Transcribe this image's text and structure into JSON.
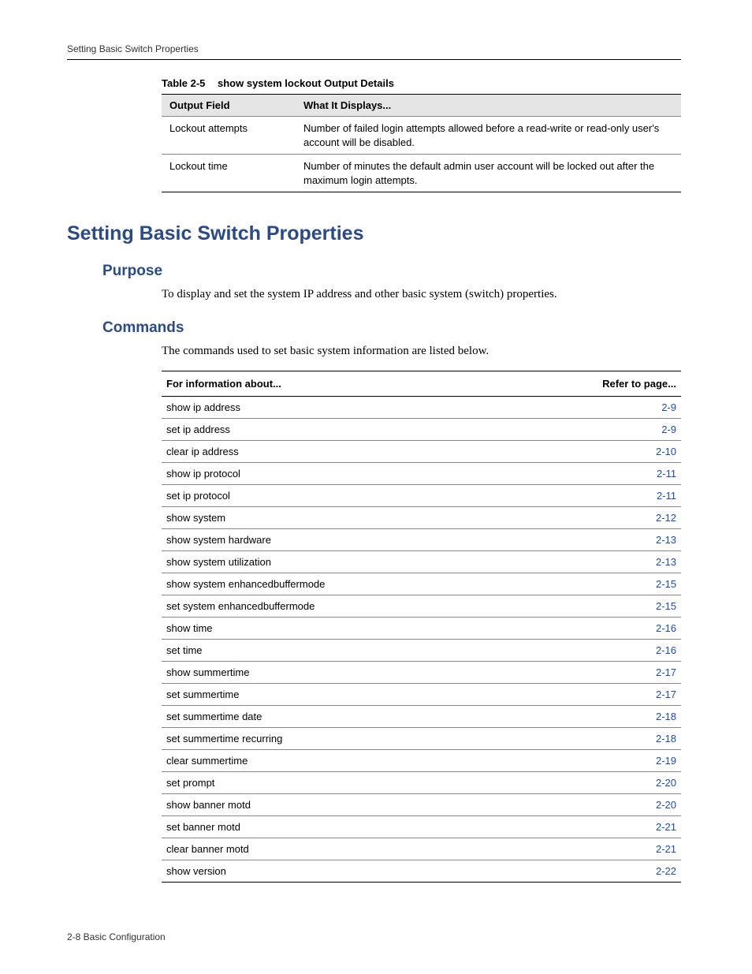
{
  "header": {
    "running_title": "Setting Basic Switch Properties"
  },
  "table25": {
    "caption_num": "Table 2-5",
    "caption_text": "show system lockout Output Details",
    "col1": "Output Field",
    "col2": "What It Displays...",
    "rows": [
      {
        "field": "Lockout attempts",
        "desc": "Number of failed login attempts allowed before a read-write or read-only user's account will be disabled."
      },
      {
        "field": "Lockout time",
        "desc": "Number of minutes the default admin user account will be locked out after the maximum login attempts."
      }
    ]
  },
  "section": {
    "title": "Setting Basic Switch Properties",
    "purpose_h": "Purpose",
    "purpose_body": "To display and set the system IP address and other basic system (switch) properties.",
    "commands_h": "Commands",
    "commands_body": "The commands used to set basic system information are listed below."
  },
  "index": {
    "col1": "For information about...",
    "col2": "Refer to page...",
    "rows": [
      {
        "cmd": "show ip address",
        "page": "2-9"
      },
      {
        "cmd": "set ip address",
        "page": "2-9"
      },
      {
        "cmd": "clear ip address",
        "page": "2-10"
      },
      {
        "cmd": "show ip protocol",
        "page": "2-11"
      },
      {
        "cmd": "set ip protocol",
        "page": "2-11"
      },
      {
        "cmd": "show system",
        "page": "2-12"
      },
      {
        "cmd": "show system hardware",
        "page": "2-13"
      },
      {
        "cmd": "show system utilization",
        "page": "2-13"
      },
      {
        "cmd": "show system enhancedbuffermode",
        "page": "2-15"
      },
      {
        "cmd": "set system enhancedbuffermode",
        "page": "2-15"
      },
      {
        "cmd": "show time",
        "page": "2-16"
      },
      {
        "cmd": "set time",
        "page": "2-16"
      },
      {
        "cmd": "show summertime",
        "page": "2-17"
      },
      {
        "cmd": "set summertime",
        "page": "2-17"
      },
      {
        "cmd": "set summertime date",
        "page": "2-18"
      },
      {
        "cmd": "set summertime recurring",
        "page": "2-18"
      },
      {
        "cmd": "clear summertime",
        "page": "2-19"
      },
      {
        "cmd": "set prompt",
        "page": "2-20"
      },
      {
        "cmd": "show banner motd",
        "page": "2-20"
      },
      {
        "cmd": "set banner motd",
        "page": "2-21"
      },
      {
        "cmd": "clear banner motd",
        "page": "2-21"
      },
      {
        "cmd": "show version",
        "page": "2-22"
      }
    ]
  },
  "footer": {
    "text": "2-8   Basic Configuration"
  }
}
